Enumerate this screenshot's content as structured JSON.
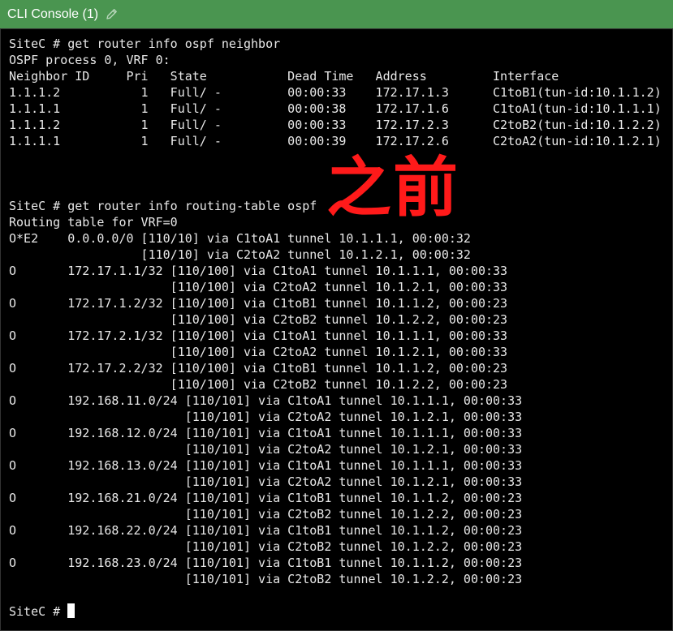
{
  "window": {
    "title": "CLI Console (1)",
    "edit_icon": "pencil-icon"
  },
  "console": {
    "lines": [
      "SiteC # get router info ospf neighbor",
      "OSPF process 0, VRF 0:",
      "Neighbor ID     Pri   State           Dead Time   Address         Interface",
      "1.1.1.2           1   Full/ -         00:00:33    172.17.1.3      C1toB1(tun-id:10.1.1.2)",
      "1.1.1.1           1   Full/ -         00:00:38    172.17.1.6      C1toA1(tun-id:10.1.1.1)",
      "1.1.1.2           1   Full/ -         00:00:33    172.17.2.3      C2toB2(tun-id:10.1.2.2)",
      "1.1.1.1           1   Full/ -         00:00:39    172.17.2.6      C2toA2(tun-id:10.1.2.1)",
      "",
      "",
      "",
      "SiteC # get router info routing-table ospf",
      "Routing table for VRF=0",
      "O*E2    0.0.0.0/0 [110/10] via C1toA1 tunnel 10.1.1.1, 00:00:32",
      "                  [110/10] via C2toA2 tunnel 10.1.2.1, 00:00:32",
      "O       172.17.1.1/32 [110/100] via C1toA1 tunnel 10.1.1.1, 00:00:33",
      "                      [110/100] via C2toA2 tunnel 10.1.2.1, 00:00:33",
      "O       172.17.1.2/32 [110/100] via C1toB1 tunnel 10.1.1.2, 00:00:23",
      "                      [110/100] via C2toB2 tunnel 10.1.2.2, 00:00:23",
      "O       172.17.2.1/32 [110/100] via C1toA1 tunnel 10.1.1.1, 00:00:33",
      "                      [110/100] via C2toA2 tunnel 10.1.2.1, 00:00:33",
      "O       172.17.2.2/32 [110/100] via C1toB1 tunnel 10.1.1.2, 00:00:23",
      "                      [110/100] via C2toB2 tunnel 10.1.2.2, 00:00:23",
      "O       192.168.11.0/24 [110/101] via C1toA1 tunnel 10.1.1.1, 00:00:33",
      "                        [110/101] via C2toA2 tunnel 10.1.2.1, 00:00:33",
      "O       192.168.12.0/24 [110/101] via C1toA1 tunnel 10.1.1.1, 00:00:33",
      "                        [110/101] via C2toA2 tunnel 10.1.2.1, 00:00:33",
      "O       192.168.13.0/24 [110/101] via C1toA1 tunnel 10.1.1.1, 00:00:33",
      "                        [110/101] via C2toA2 tunnel 10.1.2.1, 00:00:33",
      "O       192.168.21.0/24 [110/101] via C1toB1 tunnel 10.1.1.2, 00:00:23",
      "                        [110/101] via C2toB2 tunnel 10.1.2.2, 00:00:23",
      "O       192.168.22.0/24 [110/101] via C1toB1 tunnel 10.1.1.2, 00:00:23",
      "                        [110/101] via C2toB2 tunnel 10.1.2.2, 00:00:23",
      "O       192.168.23.0/24 [110/101] via C1toB1 tunnel 10.1.1.2, 00:00:23",
      "                        [110/101] via C2toB2 tunnel 10.1.2.2, 00:00:23",
      "",
      "SiteC # "
    ],
    "cursor": "block-cursor"
  },
  "annotation": {
    "text": "之前",
    "color": "#ff1a1a"
  },
  "colors": {
    "titlebar_bg": "#4a9550",
    "console_bg": "#000000",
    "console_text": "#e8e8e8"
  }
}
